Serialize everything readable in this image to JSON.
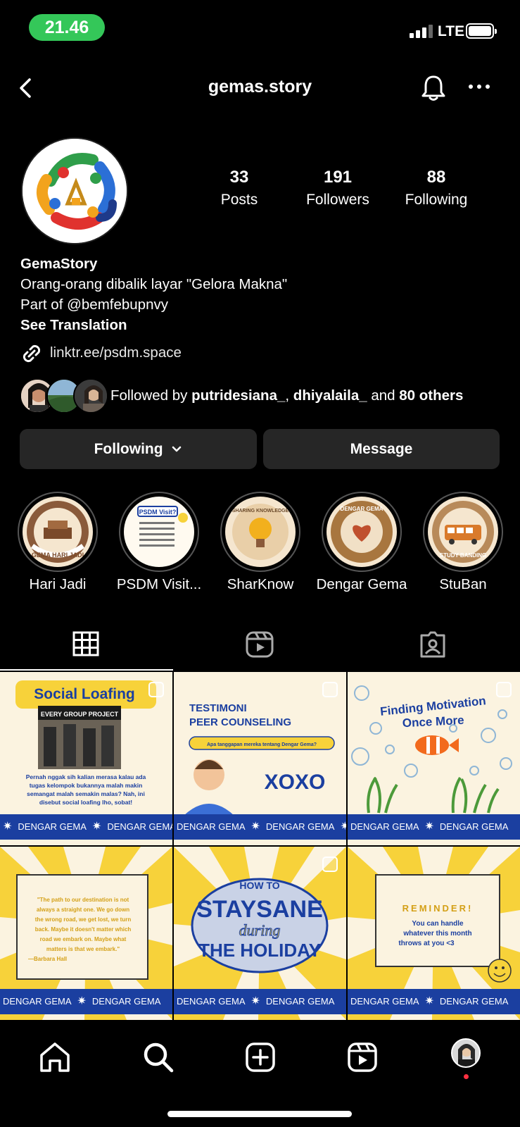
{
  "status_bar": {
    "time": "21.46",
    "network": "LTE"
  },
  "header": {
    "username": "gemas.story"
  },
  "profile": {
    "stats": [
      {
        "value": "33",
        "label": "Posts"
      },
      {
        "value": "191",
        "label": "Followers"
      },
      {
        "value": "88",
        "label": "Following"
      }
    ],
    "display_name": "GemaStory",
    "bio_line1": "Orang-orang dibalik layar \"Gelora Makna\"",
    "bio_line2": "Part of @bemfebupnvy",
    "see_translation": "See Translation",
    "link": "linktr.ee/psdm.space",
    "followed_by_prefix": "Followed by ",
    "followed_by_user1": "putridesiana_",
    "followed_by_sep": ", ",
    "followed_by_user2": "dhiyalaila_",
    "followed_by_and": " and ",
    "followed_by_others": "80 others"
  },
  "buttons": {
    "following": "Following",
    "message": "Message"
  },
  "highlights": [
    {
      "label": "Hari Jadi",
      "art_text": "GEMA HARI JADI"
    },
    {
      "label": "PSDM Visit...",
      "art_text": "PSDM Visit?"
    },
    {
      "label": "SharKnow",
      "art_text": "SHARING KNOWLEDGE"
    },
    {
      "label": "Dengar Gema",
      "art_text": "DENGAR GEMA"
    },
    {
      "label": "StuBan",
      "art_text": "STUDY BANDING"
    }
  ],
  "posts": [
    {
      "title": "Social Loafing",
      "subtitle": "EVERY GROUP PROJECT",
      "body": "Pernah nggak sih kalian merasa kalau ada tugas kelompok bukannya malah makin semangat malah semakin malas? Nah, ini disebut social loafing lho, sobat!"
    },
    {
      "title": "TESTIMONI PEER COUNSELING",
      "subtitle": "Apa tanggapan mereka tentang Dengar Gema?",
      "body": "XOXO"
    },
    {
      "title": "Finding Motivation Once More",
      "subtitle": "",
      "body": ""
    },
    {
      "title": "",
      "subtitle": "",
      "body": "\"The path to our destination is not always a straight one. We go down the wrong road, we get lost, we turn back. Maybe it doesn't matter which road we embark on. Maybe what matters is that we embark.\" —Barbara Hall"
    },
    {
      "title": "STAYSANE during THE HOLIDAY",
      "subtitle": "HOW TO",
      "body": ""
    },
    {
      "title": "REMINDER!",
      "subtitle": "",
      "body": "You can handle whatever this month throws at you <3"
    }
  ],
  "post_band": {
    "left": "DENGAR GEMA",
    "right": "DENGAR GEMA"
  },
  "icons": {
    "back": "chevron-left-icon",
    "bell": "bell-icon",
    "more": "more-icon",
    "link": "link-icon",
    "grid": "grid-icon",
    "reels": "reels-icon",
    "tagged": "tagged-icon",
    "home": "home-icon",
    "search": "search-icon",
    "create": "create-icon"
  },
  "colors": {
    "background": "#000000",
    "button": "#262626",
    "time_pill": "#34c759",
    "post_band": "#1b3fa0",
    "post_yellow": "#f7d23a"
  }
}
